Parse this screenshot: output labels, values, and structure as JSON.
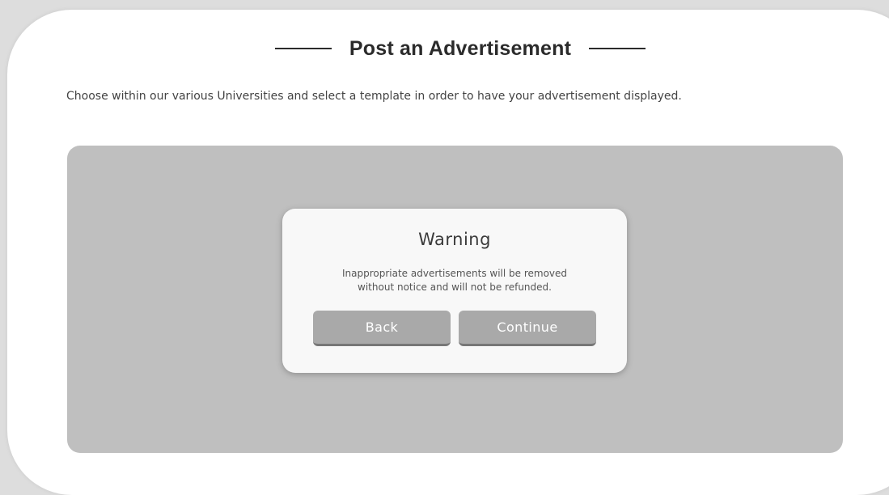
{
  "page": {
    "title": "Post an Advertisement",
    "intro": "Choose within our various Universities and select a template in order to have your advertisement displayed."
  },
  "dialog": {
    "title": "Warning",
    "message_line1": "Inappropriate advertisements will be removed",
    "message_line2": "without notice and will not be refunded.",
    "back_label": "Back",
    "continue_label": "Continue"
  },
  "colors": {
    "page_background": "#dddddd",
    "card_background": "#ffffff",
    "overlay_panel": "#bfbfbf",
    "dialog_background": "#f8f8f8",
    "button": "#a9a9a9",
    "title_text": "#2b2b2b"
  }
}
